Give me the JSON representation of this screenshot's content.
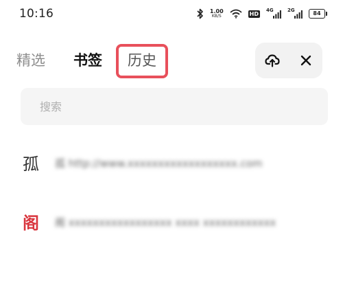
{
  "status_bar": {
    "time": "10:16",
    "net_speed_value": "1.00",
    "net_speed_unit": "KB/S",
    "hd_label": "HD",
    "signal_1_gen": "4G",
    "signal_2_gen": "2G",
    "battery_level": "84"
  },
  "tabs": {
    "selected_label": "精选",
    "bookmarks_label": "书签",
    "history_label": "历史",
    "active_tab": "书签",
    "highlight_color": "#e8505b"
  },
  "actions": {
    "sync_icon": "cloud-sync-icon",
    "close_icon": "close-icon"
  },
  "search": {
    "placeholder": "搜索",
    "value": ""
  },
  "history": {
    "items": [
      {
        "icon_char": "孤",
        "title": "孤 http://www.xxxxxxxxxxxxxxxxxx.com"
      },
      {
        "icon_char": "阁",
        "title": "阁 xxxxxxxxxxxxxxxxx xxxx xxxxxxxxxxxx"
      }
    ]
  },
  "colors": {
    "accent_red": "#d9363e",
    "highlight_red": "#e8505b"
  }
}
